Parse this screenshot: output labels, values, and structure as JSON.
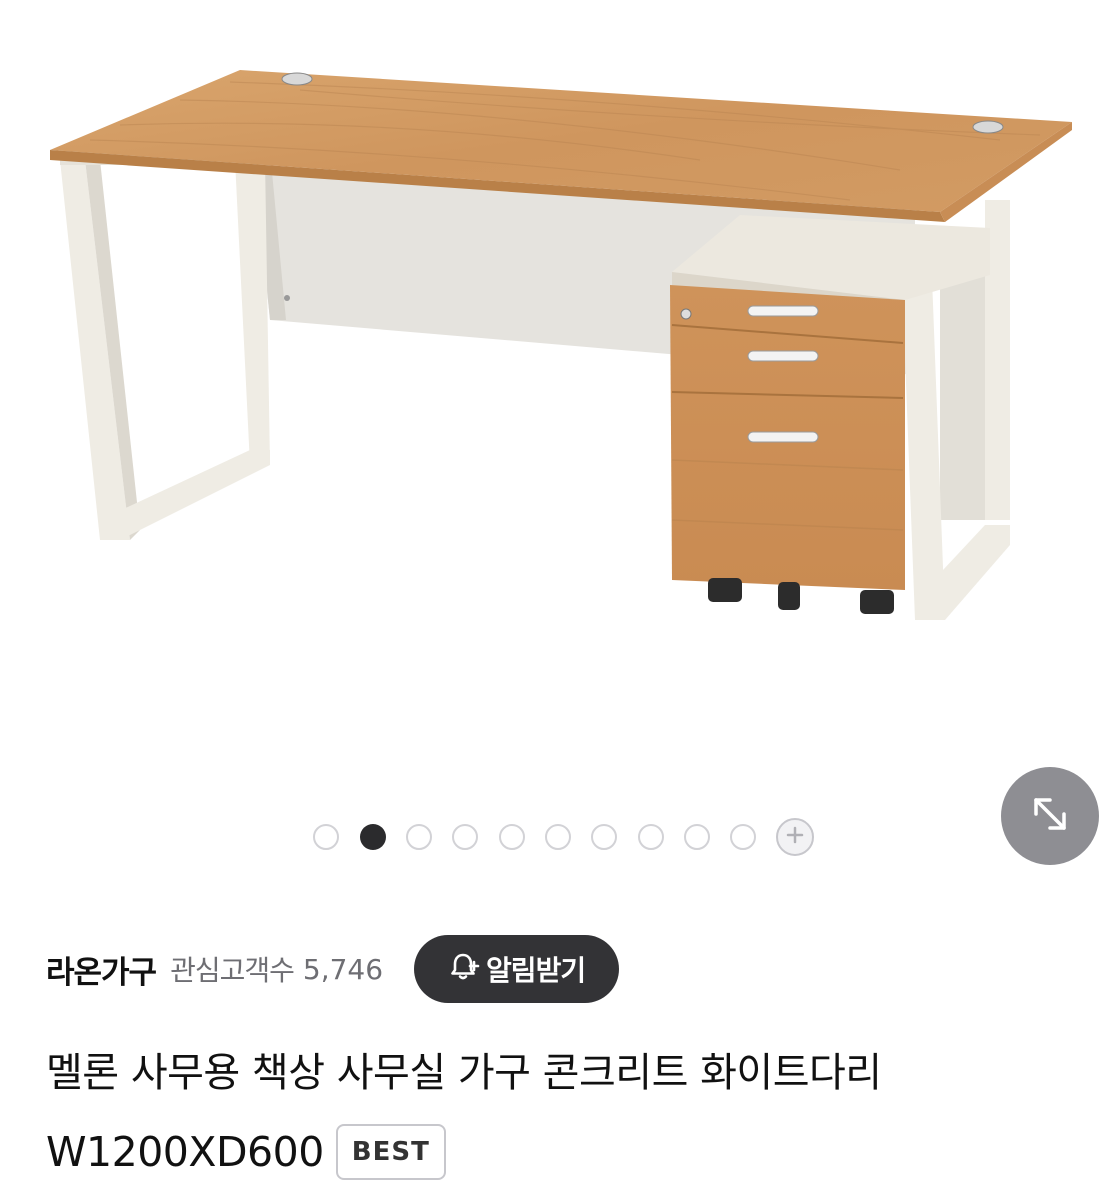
{
  "gallery": {
    "dot_count": 10,
    "active_index": 1,
    "more_icon": "plus-circle-icon",
    "expand_icon": "expand-arrows-icon"
  },
  "shop": {
    "name": "라온가구",
    "interest_label": "관심고객수",
    "interest_count": "5,746",
    "notify_label": "알림받기",
    "notify_icon": "bell-plus-icon"
  },
  "product": {
    "title_line1": "멜론 사무용 책상 사무실 가구 콘크리트 화이트다리",
    "title_line2": "W1200XD600",
    "badge": "BEST"
  },
  "colors": {
    "notify_bg": "#333336",
    "expand_bg": "#8e8e93",
    "wood": "#d49a62",
    "frame": "#efece4"
  }
}
